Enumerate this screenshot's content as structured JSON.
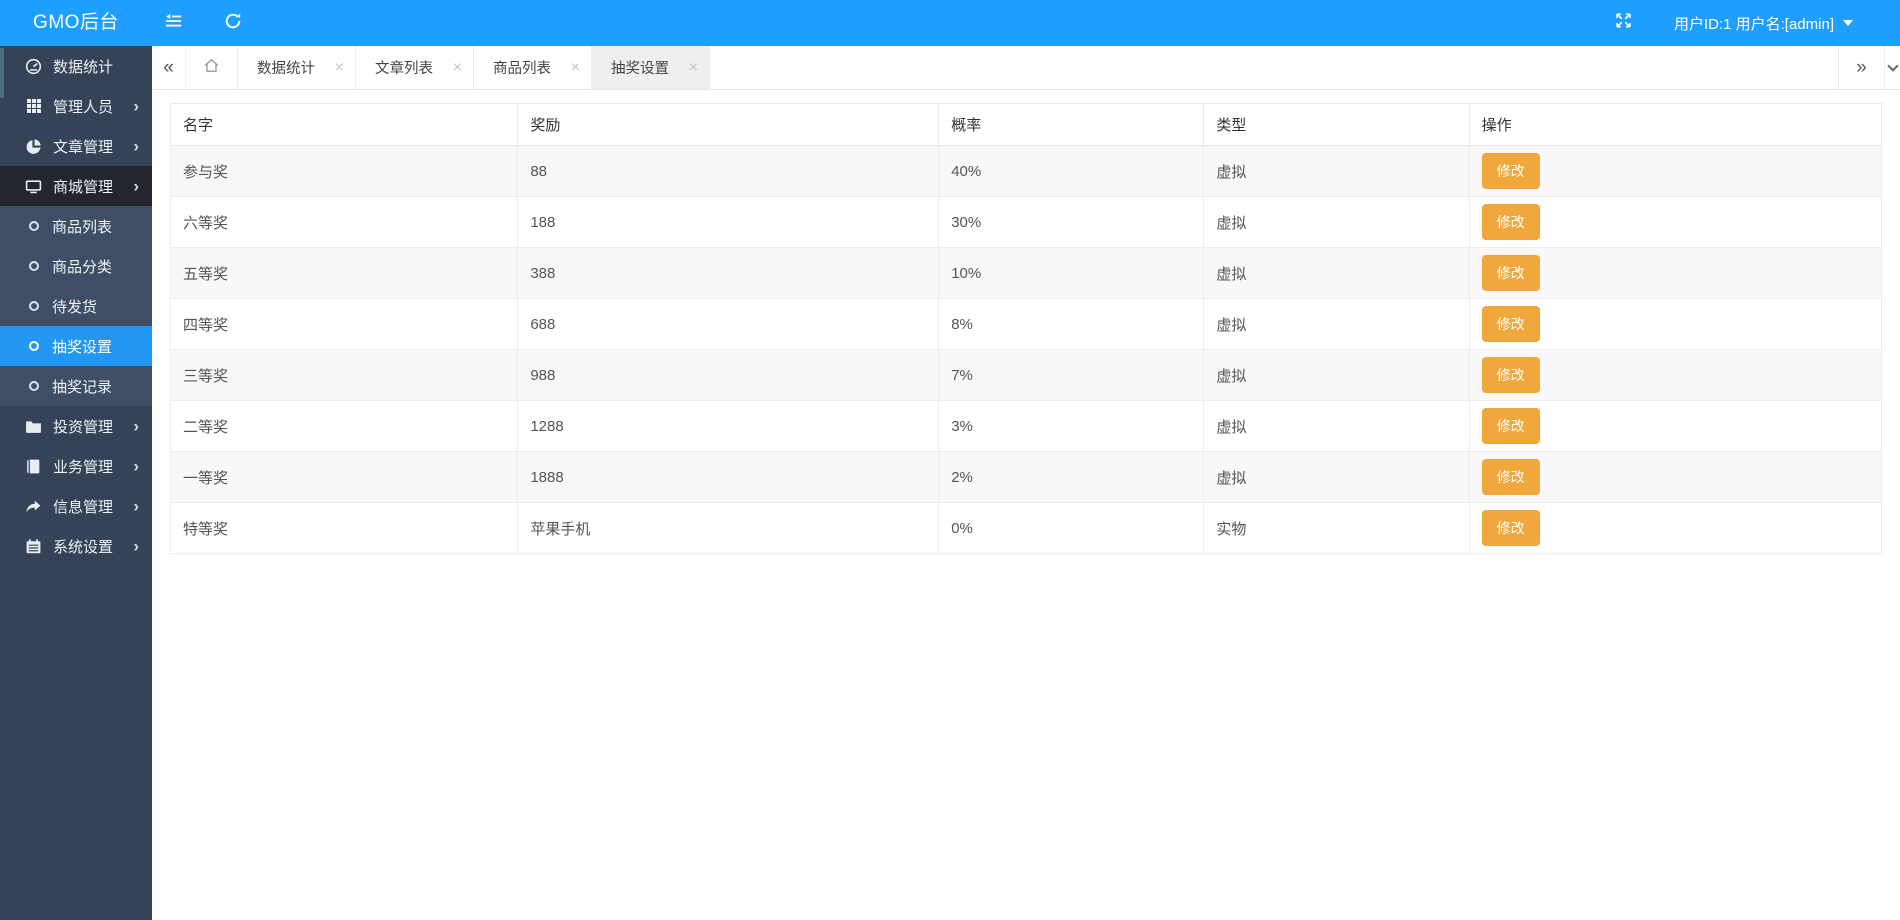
{
  "topbar": {
    "logo": "GMO后台",
    "user_label": "用户ID:1 用户名:[admin]"
  },
  "tabbar": {
    "tabs": [
      {
        "id": "data-stats",
        "label": "数据统计",
        "active": false
      },
      {
        "id": "article-list",
        "label": "文章列表",
        "active": false
      },
      {
        "id": "goods-list",
        "label": "商品列表",
        "active": false
      },
      {
        "id": "lottery-settings",
        "label": "抽奖设置",
        "active": true
      }
    ]
  },
  "sidebar": {
    "items": [
      {
        "id": "data-stats",
        "label": "数据统计",
        "icon": "dashboard-icon",
        "type": "main",
        "has_children": false,
        "expanded": false,
        "active": false
      },
      {
        "id": "admin-users",
        "label": "管理人员",
        "icon": "grid-icon",
        "type": "main",
        "has_children": true,
        "expanded": false,
        "active": false
      },
      {
        "id": "article-mgmt",
        "label": "文章管理",
        "icon": "pie-chart-icon",
        "type": "main",
        "has_children": true,
        "expanded": false,
        "active": false
      },
      {
        "id": "mall-mgmt",
        "label": "商城管理",
        "icon": "monitor-icon",
        "type": "main",
        "has_children": true,
        "expanded": true,
        "active": false
      },
      {
        "id": "goods-list",
        "label": "商品列表",
        "icon": "circle-icon",
        "type": "sub",
        "has_children": false,
        "expanded": false,
        "active": false
      },
      {
        "id": "goods-category",
        "label": "商品分类",
        "icon": "circle-icon",
        "type": "sub",
        "has_children": false,
        "expanded": false,
        "active": false
      },
      {
        "id": "pending-shipment",
        "label": "待发货",
        "icon": "circle-icon",
        "type": "sub",
        "has_children": false,
        "expanded": false,
        "active": false
      },
      {
        "id": "lottery-settings",
        "label": "抽奖设置",
        "icon": "circle-icon",
        "type": "sub",
        "has_children": false,
        "expanded": false,
        "active": true
      },
      {
        "id": "lottery-records",
        "label": "抽奖记录",
        "icon": "circle-icon",
        "type": "sub",
        "has_children": false,
        "expanded": false,
        "active": false
      },
      {
        "id": "investment-mgmt",
        "label": "投资管理",
        "icon": "folder-icon",
        "type": "main",
        "has_children": true,
        "expanded": false,
        "active": false
      },
      {
        "id": "business-mgmt",
        "label": "业务管理",
        "icon": "book-icon",
        "type": "main",
        "has_children": true,
        "expanded": false,
        "active": false
      },
      {
        "id": "info-mgmt",
        "label": "信息管理",
        "icon": "share-icon",
        "type": "main",
        "has_children": true,
        "expanded": false,
        "active": false
      },
      {
        "id": "system-settings",
        "label": "系统设置",
        "icon": "calendar-icon",
        "type": "main",
        "has_children": true,
        "expanded": false,
        "active": false
      }
    ]
  },
  "table": {
    "columns": [
      "名字",
      "奖励",
      "概率",
      "类型",
      "操作"
    ],
    "rows": [
      [
        "参与奖",
        "88",
        "40%",
        "虚拟"
      ],
      [
        "六等奖",
        "188",
        "30%",
        "虚拟"
      ],
      [
        "五等奖",
        "388",
        "10%",
        "虚拟"
      ],
      [
        "四等奖",
        "688",
        "8%",
        "虚拟"
      ],
      [
        "三等奖",
        "988",
        "7%",
        "虚拟"
      ],
      [
        "二等奖",
        "1288",
        "3%",
        "虚拟"
      ],
      [
        "一等奖",
        "1888",
        "2%",
        "虚拟"
      ],
      [
        "特等奖",
        "苹果手机",
        "0%",
        "实物"
      ]
    ],
    "action_label": "修改"
  },
  "icons": {
    "collapse_tabs": "«",
    "expand_tabs": "»",
    "close": "×",
    "chevron_right": "›"
  },
  "colors": {
    "accent": "#1E9FFF",
    "sidebar_bg": "#364257",
    "sidebar_submenu_bg": "#3F4E64",
    "sidebar_expanded_bg": "#23262E",
    "active_item": "#2196F3",
    "warn_button": "#F0A73C",
    "row_stripe": "#F8F8F8"
  }
}
